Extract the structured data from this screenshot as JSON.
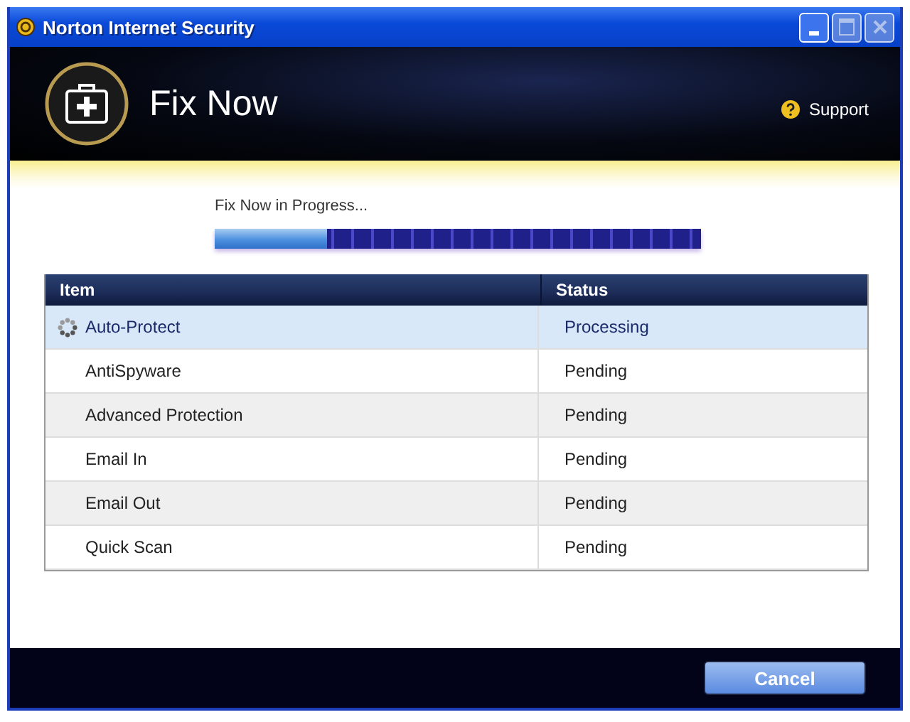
{
  "window": {
    "title": "Norton Internet Security"
  },
  "header": {
    "title": "Fix Now",
    "support": "Support"
  },
  "progress": {
    "label": "Fix Now in Progress...",
    "level": 0.23
  },
  "table": {
    "columns": [
      "Item",
      "Status"
    ],
    "rows": [
      {
        "item": "Auto-Protect",
        "status": "Processing",
        "selected": true,
        "in_progress": true
      },
      {
        "item": "AntiSpyware",
        "status": "Pending",
        "selected": false,
        "in_progress": false
      },
      {
        "item": "Advanced Protection",
        "status": "Pending",
        "selected": false,
        "in_progress": false
      },
      {
        "item": "Email In",
        "status": "Pending",
        "selected": false,
        "in_progress": false
      },
      {
        "item": "Email Out",
        "status": "Pending",
        "selected": false,
        "in_progress": false
      },
      {
        "item": "Quick Scan",
        "status": "Pending",
        "selected": false,
        "in_progress": false
      }
    ]
  },
  "buttons": [
    {
      "label": "Cancel"
    }
  ]
}
